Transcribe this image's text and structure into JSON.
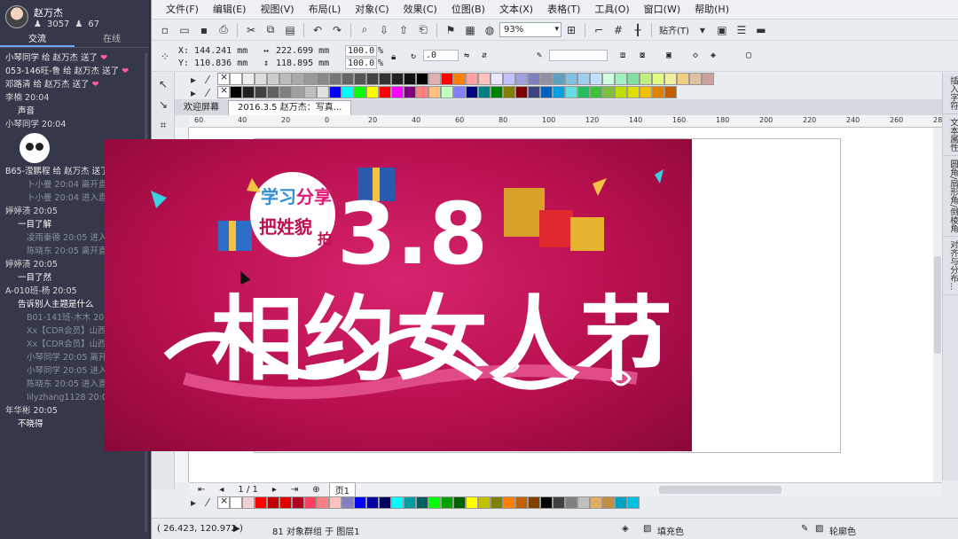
{
  "chat": {
    "user_name": "赵万杰",
    "fans": "3057",
    "likes": "67",
    "tabs": [
      "交流",
      "在线"
    ],
    "messages": [
      {
        "type": "gift",
        "text": "小琴同学 给 赵万杰 送了"
      },
      {
        "type": "gift",
        "text": "053-146旺-鲁 给 赵万杰 送了"
      },
      {
        "type": "gift",
        "text": "邓路清 给 赵万杰 送了"
      },
      {
        "type": "name",
        "text": "李楠 20:04"
      },
      {
        "type": "text",
        "text": "声音"
      },
      {
        "type": "name",
        "text": "小琴同学 20:04"
      },
      {
        "type": "sticker",
        "text": ""
      },
      {
        "type": "gift",
        "text": "B65-滢鹏程 给 赵万杰 送了"
      },
      {
        "type": "sys",
        "text": "卜小曼 20:04 离开直播间"
      },
      {
        "type": "sys",
        "text": "卜小曼 20:04 进入直播间"
      },
      {
        "type": "name",
        "text": "婷婷渍 20:05"
      },
      {
        "type": "text",
        "text": "一目了解"
      },
      {
        "type": "sys",
        "text": "凌雨秦德 20:05 进入直播间"
      },
      {
        "type": "sys",
        "text": "陈晓东 20:05 离开直播间"
      },
      {
        "type": "name",
        "text": "婷婷渍 20:05"
      },
      {
        "type": "text",
        "text": "一目了然"
      },
      {
        "type": "name",
        "text": "A-010班-杨 20:05"
      },
      {
        "type": "text",
        "text": "告诉别人主题是什么"
      },
      {
        "type": "sys",
        "text": "B01-141班-木木 20:05 进入直播间"
      },
      {
        "type": "sys",
        "text": "Xx【CDR会员】山西孙三 20:05 离开直播间"
      },
      {
        "type": "sys",
        "text": "Xx【CDR会员】山西孙三 20:05 进入直播间"
      },
      {
        "type": "sys",
        "text": "小琴同学 20:05 离开直播间"
      },
      {
        "type": "sys",
        "text": "小琴同学 20:05 进入直播间"
      },
      {
        "type": "sys",
        "text": "陈晓东 20:05 进入直播间"
      },
      {
        "type": "sys",
        "text": "lilyzhang1128 20:05 进入直播间"
      },
      {
        "type": "name",
        "text": "年华彬 20:05"
      },
      {
        "type": "text",
        "text": "不晓得"
      }
    ]
  },
  "menu": [
    "文件(F)",
    "编辑(E)",
    "视图(V)",
    "布局(L)",
    "对象(C)",
    "效果(C)",
    "位图(B)",
    "文本(X)",
    "表格(T)",
    "工具(O)",
    "窗口(W)",
    "帮助(H)"
  ],
  "toolbar": {
    "zoom": "93%",
    "snap": "贴齐(T)"
  },
  "props": {
    "x": "X: 144.241 mm",
    "y": "Y: 110.836 mm",
    "w": "222.699 mm",
    "h": "118.895 mm",
    "sx": "100.0",
    "sy": "100.0",
    "pct": "%",
    "angle": ".0"
  },
  "doc_tabs": [
    "欢迎屏幕",
    "2016.3.5 赵万杰：写真..."
  ],
  "ruler_labels": [
    "60",
    "40",
    "20",
    "0",
    "20",
    "40",
    "60",
    "80",
    "100",
    "120",
    "140",
    "160",
    "180",
    "200",
    "220",
    "240",
    "260",
    "280"
  ],
  "pagebar": {
    "page_count": "1 / 1",
    "page_tab": "页1"
  },
  "status": {
    "coords": "( 26.423, 120.972 )",
    "selection": "81 对象群组 于 图层1",
    "fill": "填充色",
    "outline": "轮廓色"
  },
  "dockers": [
    "插入字符",
    "文本属性",
    "圆角/扇形角/倒棱角",
    "对齐与分布..."
  ],
  "poster": {
    "badge_top": "学习",
    "badge_top2": "分享",
    "badge_bottom": "把姓貌",
    "badge_bottom2": "拍",
    "number": "3.8",
    "headline": "相约女人节"
  },
  "colors": {
    "poster_bg": "#b8104f",
    "accent": "#ffffff"
  },
  "palette_top": [
    "#ffffff",
    "#eeeeee",
    "#dddddd",
    "#cccccc",
    "#bbbbbb",
    "#aaaaaa",
    "#999999",
    "#888888",
    "#777777",
    "#666666",
    "#555555",
    "#444444",
    "#333333",
    "#222222",
    "#111111",
    "#000000",
    "#e0b0b0",
    "#ff0000",
    "#ff7f00",
    "#ffa0a0",
    "#ffc0c0",
    "#e8e8ff",
    "#c0c0ff",
    "#a0a0e0",
    "#8080c0",
    "#9090a0",
    "#60a0c0",
    "#80c0e0",
    "#a0d0f0",
    "#c0e0ff",
    "#d0ffe0",
    "#a0f0c0",
    "#80e0a0",
    "#c0f080",
    "#e0ff80",
    "#f0f0a0",
    "#f0d080",
    "#e0c0a0",
    "#d0a0a0"
  ],
  "palette_mid": [
    "#000000",
    "#202020",
    "#404040",
    "#606060",
    "#808080",
    "#a0a0a0",
    "#c0c0c0",
    "#e0e0e0",
    "#0000ff",
    "#00ffff",
    "#00ff00",
    "#ffff00",
    "#ff0000",
    "#ff00ff",
    "#800080",
    "#ff8080",
    "#ffc080",
    "#c0ffc0",
    "#8080ff",
    "#000080",
    "#008080",
    "#008000",
    "#808000",
    "#800000",
    "#404080",
    "#0060c0",
    "#00a0e0",
    "#60e0e0",
    "#20c060",
    "#40c040",
    "#80c040",
    "#c0e000",
    "#e0e000",
    "#f0c000",
    "#e08000",
    "#c06000"
  ],
  "palette_bottom": [
    "#ffffff",
    "#f0d0d0",
    "#ff0000",
    "#c00000",
    "#e00000",
    "#b00020",
    "#ff4060",
    "#ff8080",
    "#ffc0c0",
    "#8080c0",
    "#0000ff",
    "#0000a0",
    "#000060",
    "#00ffff",
    "#00a0a0",
    "#006060",
    "#00ff00",
    "#00a000",
    "#006000",
    "#ffff00",
    "#c0c000",
    "#808000",
    "#ff8000",
    "#c06000",
    "#804000",
    "#000000",
    "#404040",
    "#808080",
    "#c0c0c0",
    "#e0b060",
    "#c09040",
    "#00a0c0",
    "#00c0e0"
  ]
}
